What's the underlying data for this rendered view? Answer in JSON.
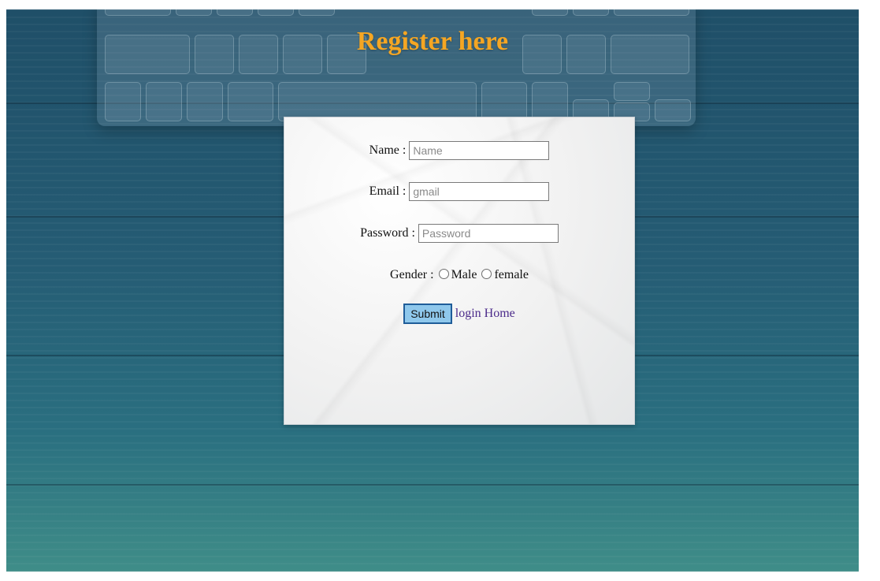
{
  "page": {
    "title": "Register here"
  },
  "form": {
    "name": {
      "label": "Name :",
      "placeholder": "Name",
      "value": ""
    },
    "email": {
      "label": "Email :",
      "placeholder": "gmail",
      "value": ""
    },
    "password": {
      "label": "Password :",
      "placeholder": "Password",
      "value": ""
    },
    "gender": {
      "label": "Gender :",
      "options": [
        {
          "label": "Male",
          "selected": false
        },
        {
          "label": "female",
          "selected": false
        }
      ]
    },
    "submit_label": "Submit",
    "login_link": "login",
    "home_link": "Home"
  },
  "colors": {
    "title": "#f5a623",
    "submit_bg": "#8fc8ec",
    "submit_border": "#1f5d99",
    "link": "#4b2a8a"
  }
}
